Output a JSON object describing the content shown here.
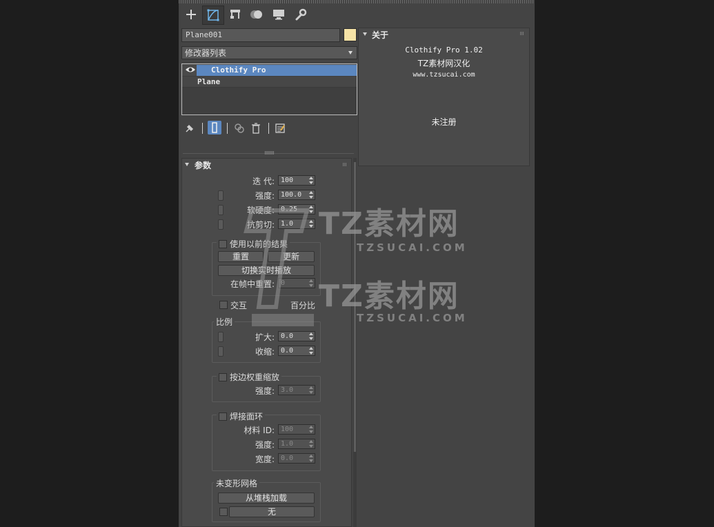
{
  "tabs": [
    {
      "name": "create",
      "icon": "plus-icon"
    },
    {
      "name": "modify",
      "icon": "modify-curve-icon"
    },
    {
      "name": "hierarchy",
      "icon": "hierarchy-icon"
    },
    {
      "name": "motion",
      "icon": "motion-icon"
    },
    {
      "name": "display",
      "icon": "display-monitor-icon"
    },
    {
      "name": "utilities",
      "icon": "wrench-icon"
    }
  ],
  "object": {
    "name": "Plane001",
    "color": "#f6e3a6"
  },
  "modifier_list": {
    "label": "修改器列表"
  },
  "stack": {
    "items": [
      {
        "label": "Clothify Pro",
        "selected": true,
        "icon": "eye-icon"
      },
      {
        "label": "Plane",
        "selected": false
      }
    ]
  },
  "params": {
    "title": "参数",
    "iterations": {
      "label": "迭 代:",
      "value": "100"
    },
    "strength": {
      "label": "强度:",
      "value": "100.0"
    },
    "softness": {
      "label": "软硬度:",
      "value": "0.25"
    },
    "shear": {
      "label": "抗剪切:",
      "value": "1.0"
    },
    "use_prev": {
      "label": "使用以前的结果",
      "reset": "重置",
      "update": "更新",
      "toggle_realtime": "切换实时播放",
      "reset_at_frame_label": "在帧中重置:",
      "reset_at_frame_value": "0"
    },
    "interact": {
      "label": "交互",
      "percent": "百分比"
    },
    "scale": {
      "title": "比例",
      "expand_label": "扩大:",
      "expand_value": "0.0",
      "shrink_label": "收缩:",
      "shrink_value": "0.0"
    },
    "edge_weight": {
      "title": "按边权重缩放",
      "strength_label": "强度:",
      "strength_value": "3.0"
    },
    "weld": {
      "title": "焊接面环",
      "material_label": "材料 ID:",
      "material_value": "100",
      "strength_label": "强度:",
      "strength_value": "1.0",
      "width_label": "宽度:",
      "width_value": "0.0"
    },
    "undeformed": {
      "title": "未变形网格",
      "load_button": "从堆栈加载",
      "none_button": "无"
    }
  },
  "about": {
    "title": "关于",
    "line1": "Clothify Pro 1.02",
    "line2": "TZ素材网汉化",
    "line3": "www.tzsucai.com",
    "status": "未注册"
  },
  "watermark": {
    "big": "TZ素材网",
    "small": "TZSUCAI.COM"
  }
}
